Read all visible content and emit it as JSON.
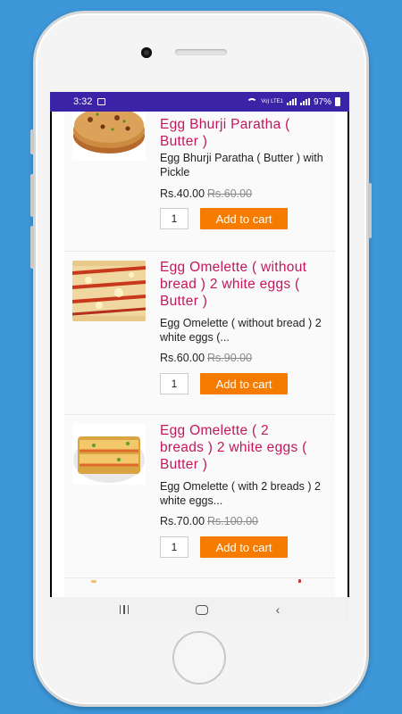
{
  "status_bar": {
    "time": "3:32",
    "network_label": "Vo) LTE1",
    "battery": "97%"
  },
  "products": [
    {
      "title": "Egg Bhurji Paratha ( Butter )",
      "description": "Egg Bhurji Paratha ( Butter ) with Pickle",
      "price": "Rs.40.00",
      "old_price": "Rs.60.00",
      "qty": "1",
      "add_label": "Add to cart",
      "image": "paratha-image"
    },
    {
      "title": "Egg Omelette ( without bread ) 2 white eggs ( Butter )",
      "description": "Egg Omelette ( without bread ) 2 white eggs (...",
      "price": "Rs.60.00",
      "old_price": "Rs.90.00",
      "qty": "1",
      "add_label": "Add to cart",
      "image": "omelette-image"
    },
    {
      "title": "Egg Omelette ( 2 breads ) 2 white eggs ( Butter )",
      "description": "Egg Omelette ( with 2 breads ) 2 white eggs...",
      "price": "Rs.70.00",
      "old_price": "Rs.100.00",
      "qty": "1",
      "add_label": "Add to cart",
      "image": "bread-omelette-image"
    }
  ],
  "colors": {
    "background": "#3d97d9",
    "status_bar": "#3a23a6",
    "title": "#c2185b",
    "button": "#f57c00"
  },
  "nav_icons": [
    "recent-apps-icon",
    "home-icon",
    "back-icon"
  ]
}
